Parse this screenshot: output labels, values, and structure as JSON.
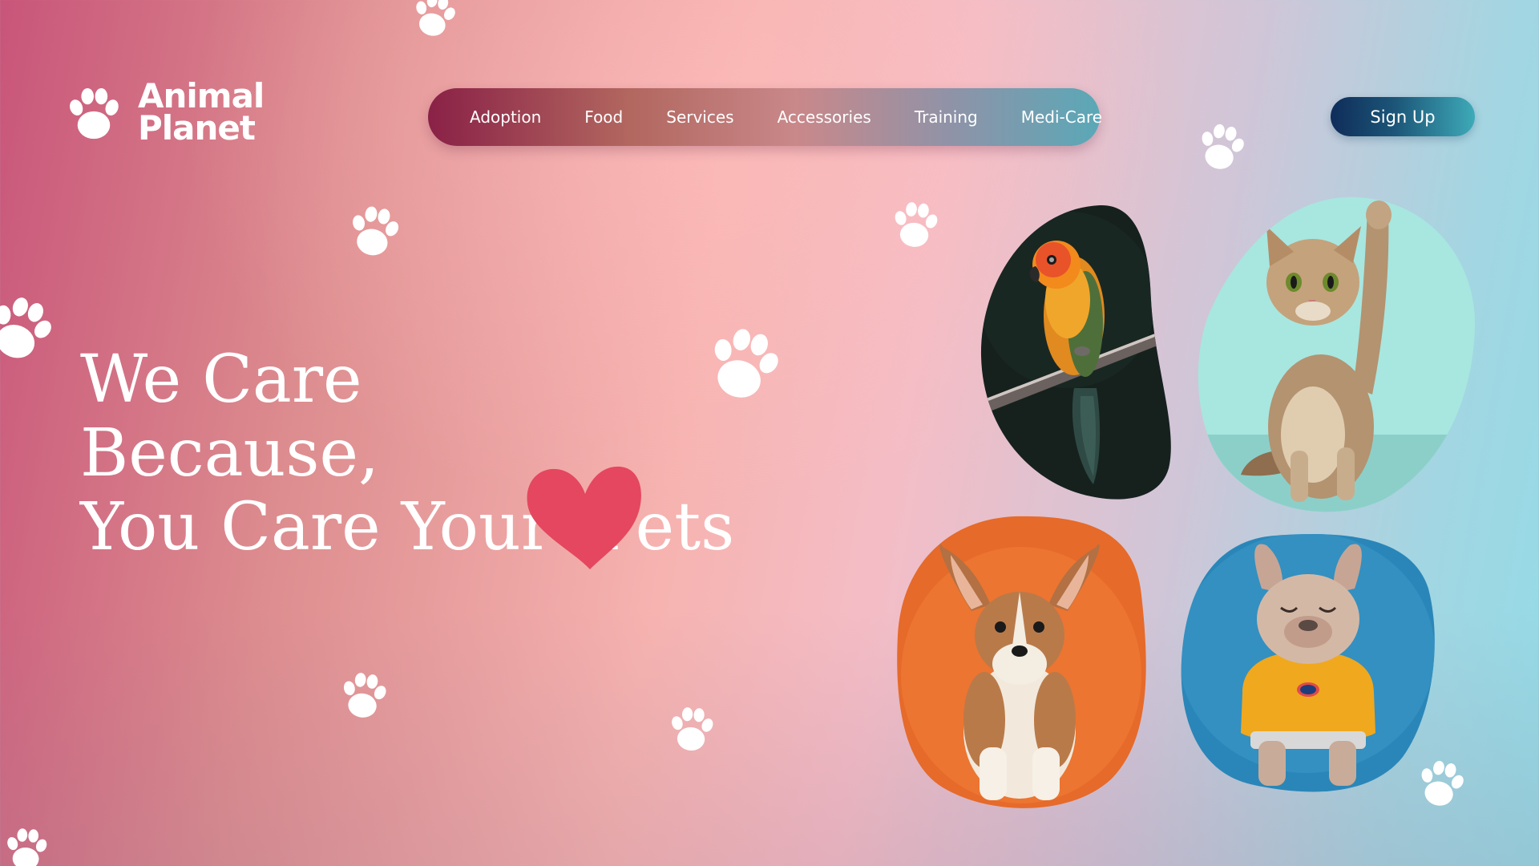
{
  "brand": {
    "name_line1": "Animal",
    "name_line2": "Planet",
    "logo_icon": "paw-icon"
  },
  "nav": {
    "items": [
      {
        "label": "Adoption"
      },
      {
        "label": "Food"
      },
      {
        "label": "Services"
      },
      {
        "label": "Accessories"
      },
      {
        "label": "Training"
      },
      {
        "label": "Medi-Care"
      }
    ]
  },
  "signup": {
    "label": "Sign Up"
  },
  "hero": {
    "line1": "We Care",
    "line2": "Because,",
    "line3": "You Care Your  Pets",
    "heart_icon": "heart-icon"
  },
  "pets": [
    {
      "name": "parrot",
      "bg": "#16211e"
    },
    {
      "name": "cat",
      "bg": "#a8e6e0"
    },
    {
      "name": "puppy",
      "bg": "#e66a2a"
    },
    {
      "name": "bulldog",
      "bg": "#2a86b8"
    }
  ],
  "colors": {
    "heart": "#e4475f",
    "white": "#ffffff"
  }
}
